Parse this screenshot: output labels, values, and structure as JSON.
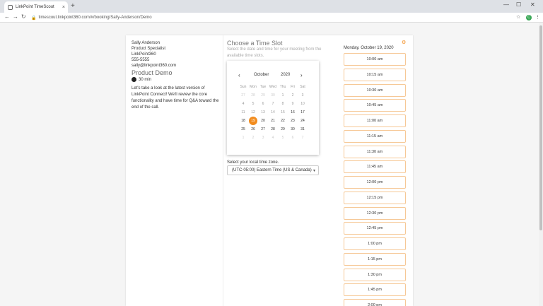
{
  "browser": {
    "tab_title": "LinkPoint TimeScout",
    "tab_close": "×",
    "new_tab": "+",
    "url": "timescout.linkpoint360.com/#/booking/Sally-Anderson/Demo",
    "profile_initial": "C",
    "win_min": "—",
    "win_max": "☐",
    "win_close": "✕",
    "back": "←",
    "forward": "→",
    "reload": "↻",
    "star": "☆",
    "menu": "⋮",
    "lock": "🔒"
  },
  "host": {
    "name": "Sally Anderson",
    "role": "Product Specialist",
    "company": "LinkPoint360",
    "phone": "555-5555",
    "email": "sally@linkpoint360.com"
  },
  "event": {
    "title": "Product Demo",
    "duration": "30 min",
    "description": "Let's take a look at the latest version of LinkPoint Connect! We'll review the core functionality and have time for Q&A toward the end of the call."
  },
  "time_slot": {
    "title": "Choose a Time Slot",
    "subtitle": "Select the date and time for your meeting from the available time slots."
  },
  "calendar": {
    "prev": "‹",
    "next": "›",
    "month": "October",
    "year": "2020",
    "weekdays": [
      "Sun",
      "Mon",
      "Tue",
      "Wed",
      "Thu",
      "Fri",
      "Sat"
    ],
    "weeks": [
      [
        {
          "d": "27",
          "s": "other"
        },
        {
          "d": "28",
          "s": "other"
        },
        {
          "d": "29",
          "s": "other"
        },
        {
          "d": "30",
          "s": "other"
        },
        {
          "d": "1",
          "s": "past"
        },
        {
          "d": "2",
          "s": "past"
        },
        {
          "d": "3",
          "s": "past"
        }
      ],
      [
        {
          "d": "4",
          "s": "past"
        },
        {
          "d": "5",
          "s": "past"
        },
        {
          "d": "6",
          "s": "past"
        },
        {
          "d": "7",
          "s": "past"
        },
        {
          "d": "8",
          "s": "past"
        },
        {
          "d": "9",
          "s": "past"
        },
        {
          "d": "10",
          "s": "past"
        }
      ],
      [
        {
          "d": "11",
          "s": "past"
        },
        {
          "d": "12",
          "s": "past"
        },
        {
          "d": "13",
          "s": "past"
        },
        {
          "d": "14",
          "s": "past"
        },
        {
          "d": "15",
          "s": "past"
        },
        {
          "d": "16",
          "s": "avail"
        },
        {
          "d": "17",
          "s": "avail"
        }
      ],
      [
        {
          "d": "18",
          "s": "avail"
        },
        {
          "d": "19",
          "s": "sel"
        },
        {
          "d": "20",
          "s": "avail"
        },
        {
          "d": "21",
          "s": "avail"
        },
        {
          "d": "22",
          "s": "avail"
        },
        {
          "d": "23",
          "s": "avail"
        },
        {
          "d": "24",
          "s": "avail"
        }
      ],
      [
        {
          "d": "25",
          "s": "avail"
        },
        {
          "d": "26",
          "s": "avail"
        },
        {
          "d": "27",
          "s": "avail"
        },
        {
          "d": "28",
          "s": "avail"
        },
        {
          "d": "29",
          "s": "avail"
        },
        {
          "d": "30",
          "s": "avail"
        },
        {
          "d": "31",
          "s": "avail"
        }
      ],
      [
        {
          "d": "1",
          "s": "other"
        },
        {
          "d": "2",
          "s": "other"
        },
        {
          "d": "3",
          "s": "other"
        },
        {
          "d": "4",
          "s": "other"
        },
        {
          "d": "5",
          "s": "other"
        },
        {
          "d": "6",
          "s": "other"
        },
        {
          "d": "7",
          "s": "other"
        }
      ]
    ],
    "accent_color": "#f28c1e"
  },
  "timezone": {
    "label": "Select your local time zone.",
    "value": "(UTC-05:00) Eastern Time (US & Canada)"
  },
  "slots": {
    "date": "Monday, October 19, 2020",
    "settings_icon": "⚙",
    "times": [
      "10:00 am",
      "10:15 am",
      "10:30 am",
      "10:45 am",
      "11:00 am",
      "11:15 am",
      "11:30 am",
      "11:45 am",
      "12:00 pm",
      "12:15 pm",
      "12:30 pm",
      "12:45 pm",
      "1:00 pm",
      "1:15 pm",
      "1:30 pm",
      "1:45 pm",
      "2:00 pm"
    ]
  }
}
